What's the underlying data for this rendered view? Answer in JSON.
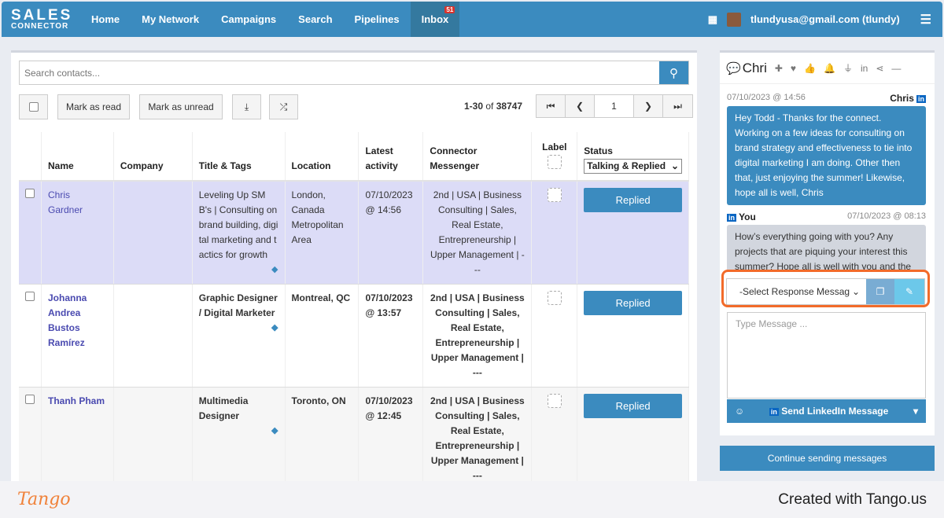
{
  "nav": {
    "logo_top": "SALES",
    "logo_bottom": "CONNECTOR",
    "items": [
      "Home",
      "My Network",
      "Campaigns",
      "Search",
      "Pipelines",
      "Inbox"
    ],
    "inbox_badge": "51",
    "user": "tlundyusa@gmail.com (tlundy)"
  },
  "toolbar": {
    "search_placeholder": "Search contacts...",
    "mark_read": "Mark as read",
    "mark_unread": "Mark as unread",
    "range": "1-30",
    "of": "of",
    "total": "38747",
    "page": "1"
  },
  "table": {
    "headers": [
      "Name",
      "Company",
      "Title & Tags",
      "Location",
      "Latest activity",
      "Connector Messenger",
      "Label",
      "Status"
    ],
    "status_filter": "Talking & Replied",
    "rows": [
      {
        "name": "Chris Gardner",
        "company": "",
        "title": "Leveling Up SMB's | Consulting on brand building, digital marketing and tactics for growth",
        "location": "London, Canada Metropolitan Area",
        "activity": "07/10/2023 @ 14:56",
        "messenger": "2nd | USA | Business Consulting | Sales, Real Estate, Entrepreneurship | Upper Management | ---",
        "status": "Replied"
      },
      {
        "name": "Johanna Andrea Bustos Ramírez",
        "company": "",
        "title": "Graphic Designer / Digital Marketer",
        "location": "Montreal, QC",
        "activity": "07/10/2023 @ 13:57",
        "messenger": "2nd | USA | Business Consulting | Sales, Real Estate, Entrepreneurship | Upper Management | ---",
        "status": "Replied"
      },
      {
        "name": "Thanh Pham",
        "company": "",
        "title": "Multimedia Designer",
        "location": "Toronto, ON",
        "activity": "07/10/2023 @ 12:45",
        "messenger": "2nd | USA | Business Consulting | Sales, Real Estate, Entrepreneurship | Upper Management | ---",
        "status": "Replied"
      }
    ]
  },
  "chat": {
    "title": "Chri",
    "messages": [
      {
        "time": "07/10/2023 @ 14:56",
        "sender": "Chris",
        "text": "Hey Todd - Thanks for the connect. Working on a few ideas for consulting on brand strategy and effectiveness to tie into digital marketing I am doing. Other then that, just enjoying the summer! Likewise, hope all is well, Chris"
      },
      {
        "time": "07/10/2023 @ 08:13",
        "sender": "You",
        "text": "How’s everything going with you? Any projects that are piquing your interest this summer? Hope all is well with you and the"
      }
    ],
    "response_select": "-Select Response Messag",
    "message_placeholder": "Type Message ...",
    "send": "Send LinkedIn Message",
    "continue": "Continue sending messages",
    "li": "in"
  },
  "footer": {
    "brand": "Tango",
    "created": "Created with Tango.us"
  }
}
